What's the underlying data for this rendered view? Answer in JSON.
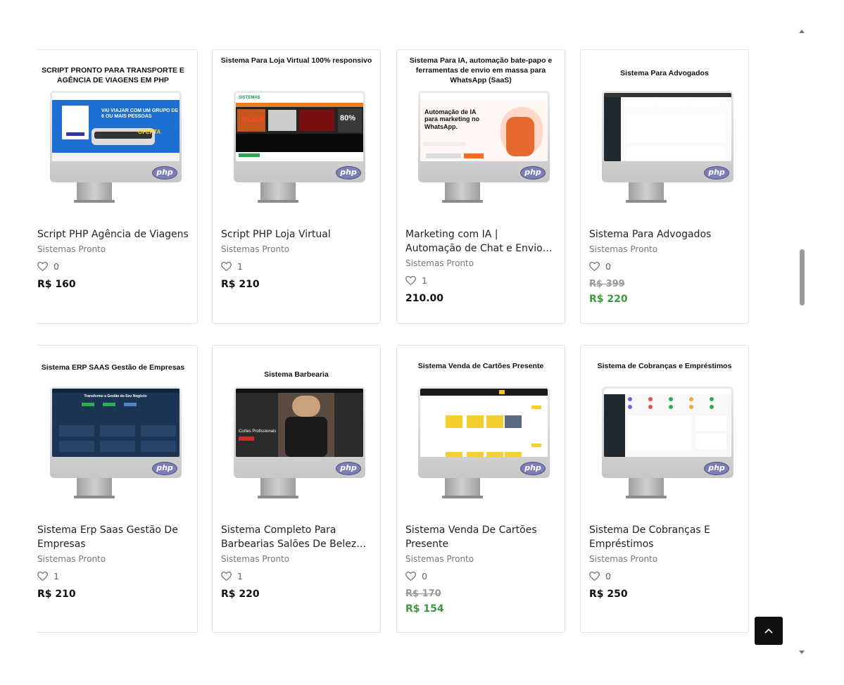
{
  "products": [
    {
      "thumb_title": "SCRIPT PRONTO PARA TRANSPORTE E AGÊNCIA DE VIAGENS EM PHP",
      "name": "Script PHP Agência de Viagens",
      "vendor": "Sistemas Pronto",
      "likes": "0",
      "price": "R$ 160",
      "old_price": "",
      "screen": "travel",
      "screen_texts": [
        "VAI VIAJAR COM UM GRUPO DE 6 OU MAIS PESSOAS",
        "OFERTA"
      ]
    },
    {
      "thumb_title": "Sistema Para Loja Virtual 100% responsivo",
      "name": "Script PHP Loja Virtual",
      "vendor": "Sistemas Pronto",
      "likes": "1",
      "price": "R$ 210",
      "old_price": "",
      "screen": "store",
      "screen_texts": [
        "SISTEMAS",
        "BLACK",
        "80%"
      ]
    },
    {
      "thumb_title": "Sistema Para IA, automação bate-papo e ferramentas de envio em massa para WhatsApp (SaaS)",
      "name": "Marketing com IA | Automação de Chat e Envio em Massa no WhatsApp",
      "vendor": "Sistemas Pronto",
      "likes": "1",
      "price": "210.00",
      "old_price": "",
      "screen": "ai",
      "screen_texts": [
        "Automação de IA para marketing no WhatsApp."
      ]
    },
    {
      "thumb_title": "Sistema Para Advogados",
      "name": "Sistema Para Advogados",
      "vendor": "Sistemas Pronto",
      "likes": "0",
      "price": "R$ 220",
      "old_price": "R$ 399",
      "screen": "lawyer",
      "screen_texts": []
    },
    {
      "thumb_title": "Sistema ERP SAAS Gestão de Empresas",
      "name": "Sistema Erp Saas Gestão De Empresas",
      "vendor": "Sistemas Pronto",
      "likes": "1",
      "price": "R$ 210",
      "old_price": "",
      "screen": "erp",
      "screen_texts": [
        "Transforme a Gestão do Seu Negócio"
      ]
    },
    {
      "thumb_title": "Sistema Barbearia",
      "name": "Sistema Completo Para Barbearias Salões De Beleza E Estética",
      "vendor": "Sistemas Pronto",
      "likes": "1",
      "price": "R$ 220",
      "old_price": "",
      "screen": "barber",
      "screen_texts": [
        "Cortes Profissionais"
      ]
    },
    {
      "thumb_title": "Sistema Venda de Cartões Presente",
      "name": "Sistema Venda De Cartões Presente",
      "vendor": "Sistemas Pronto",
      "likes": "0",
      "price": "R$ 154",
      "old_price": "R$ 170",
      "screen": "gift",
      "screen_texts": []
    },
    {
      "thumb_title": "Sistema de Cobranças e Empréstimos",
      "name": "Sistema De Cobranças E Empréstimos",
      "vendor": "Sistemas Pronto",
      "likes": "0",
      "price": "R$ 250",
      "old_price": "",
      "screen": "loans",
      "screen_texts": []
    }
  ],
  "badge_label": "php",
  "colors": {
    "sale_price": "#3c9a40",
    "border": "#e3e3e3",
    "to_top_bg": "#111111"
  },
  "icons": {
    "like": "heart-outline-icon",
    "to_top": "chevron-up-icon"
  }
}
